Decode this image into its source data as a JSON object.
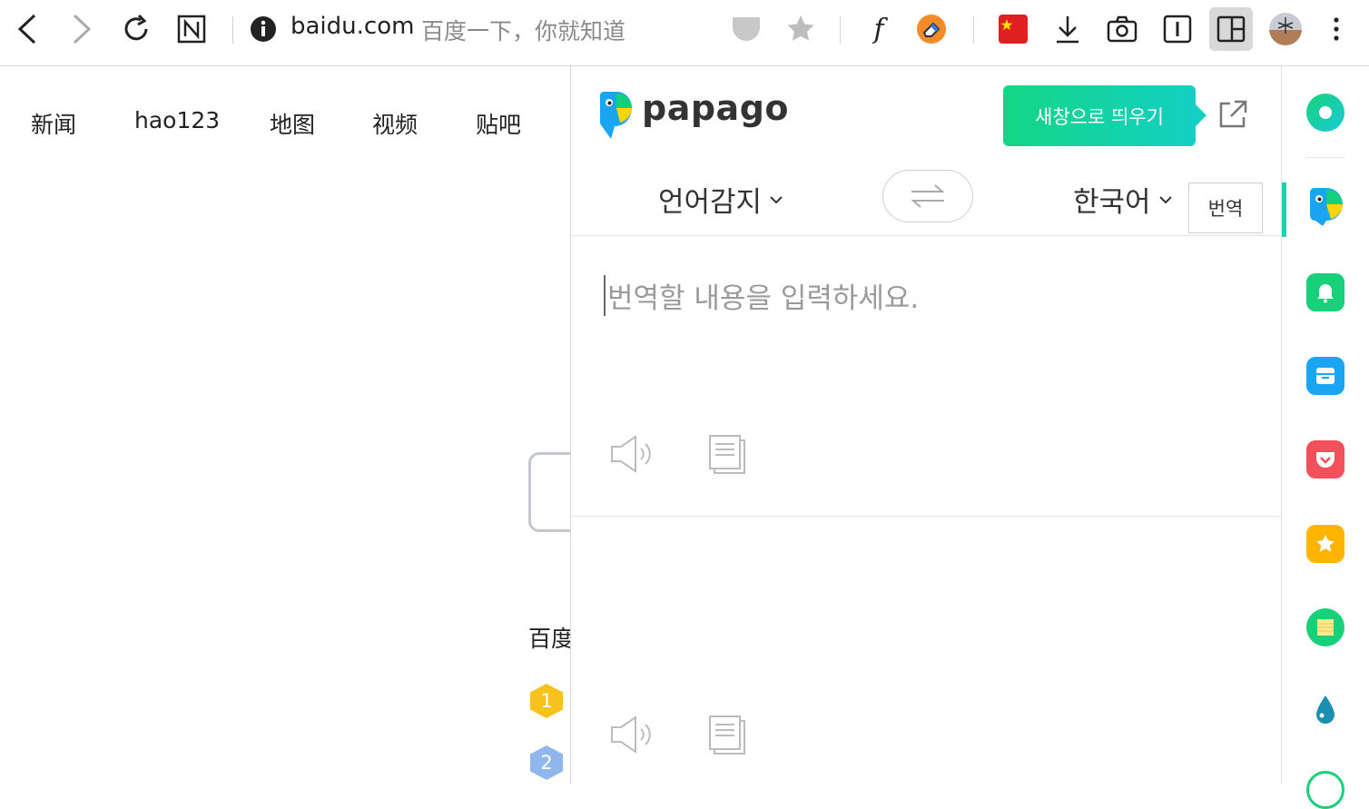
{
  "browser": {
    "url_host": "baidu.com",
    "page_title": "百度一下，你就知道",
    "toolbar_icons": [
      "back-icon",
      "forward-icon",
      "reload-icon",
      "notion-icon",
      "info-icon",
      "pocket-icon",
      "star-icon",
      "font-icon",
      "eraser-extension-icon",
      "china-flag-icon",
      "download-icon",
      "camera-icon",
      "reader-icon",
      "sidebar-toggle-icon",
      "profile-avatar-icon",
      "menu-kebab-icon"
    ]
  },
  "baidu": {
    "nav": [
      "新闻",
      "hao123",
      "地图",
      "视频",
      "贴吧"
    ],
    "hot_title": "百度",
    "hot_ranks": [
      "1",
      "2"
    ]
  },
  "papago": {
    "brand": "papago",
    "tooltip": "새창으로 띄우기",
    "source_lang": "언어감지",
    "target_lang": "한국어",
    "translate_button": "번역",
    "input_placeholder": "번역할 내용을 입력하세요.",
    "colors": {
      "accent": "#14d3a0",
      "logo_blue": "#1aa5f3",
      "logo_green": "#13d07a"
    }
  },
  "sidebar": {
    "items": [
      "whale-circle-icon",
      "papago-icon",
      "bell-icon",
      "storage-box-icon",
      "pocket-icon",
      "favorite-star-icon",
      "notes-icon",
      "water-drop-icon"
    ]
  }
}
